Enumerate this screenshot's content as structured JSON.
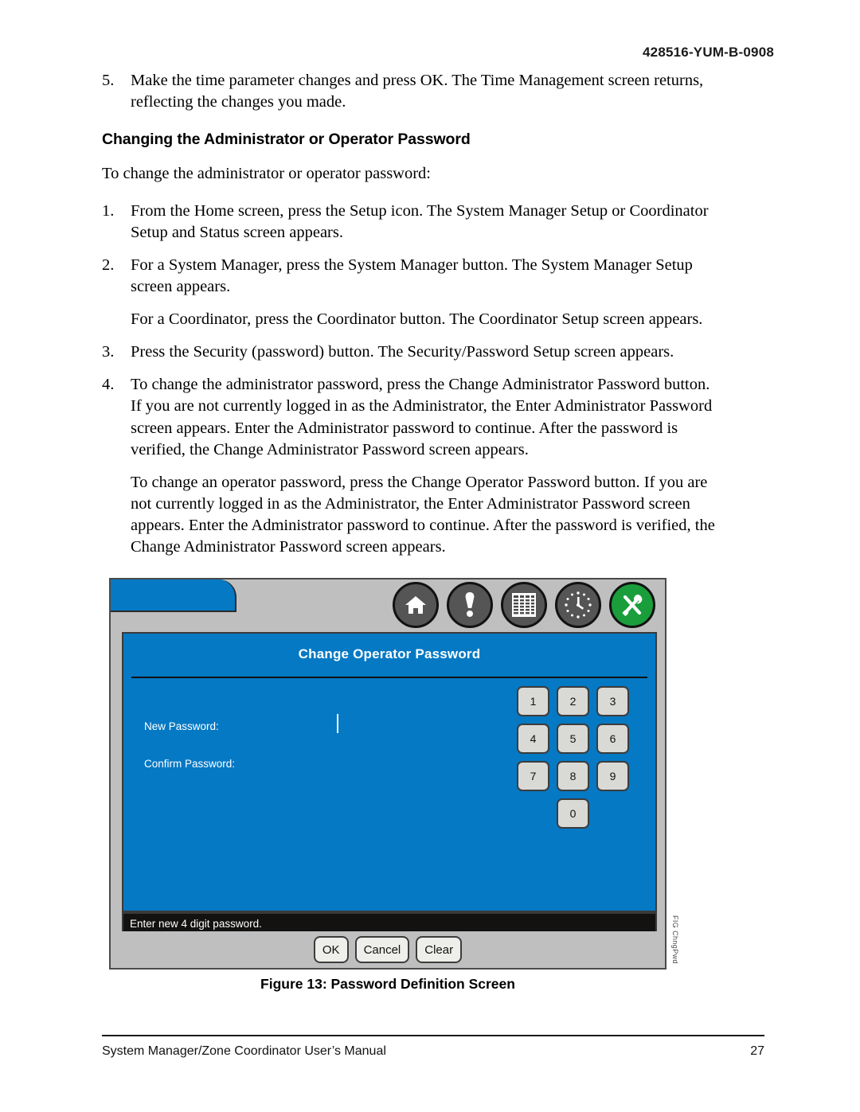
{
  "header": {
    "doc_code": "428516-YUM-B-0908"
  },
  "body": {
    "item5": {
      "num": "5.",
      "text": "Make the time parameter changes and press OK. The Time Management screen returns, reflecting the changes you made."
    },
    "heading": "Changing the Administrator or Operator Password",
    "lead": "To change the administrator or operator password:",
    "item1": {
      "num": "1.",
      "text": "From the Home screen, press the Setup icon. The System Manager Setup or Coordinator Setup and Status screen appears."
    },
    "item2": {
      "num": "2.",
      "text": "For a System Manager, press the System Manager button. The System Manager Setup screen appears."
    },
    "item2b": "For a Coordinator, press the Coordinator button. The Coordinator Setup screen appears.",
    "item3": {
      "num": "3.",
      "text": "Press the Security (password) button. The Security/Password Setup screen appears."
    },
    "item4": {
      "num": "4.",
      "text": "To change the administrator password, press the Change Administrator Password button. If you are not currently logged in as the Administrator, the Enter Administrator Password screen appears. Enter the Administrator password to continue. After the password is verified, the Change Administrator Password screen appears."
    },
    "item4b": "To change an operator password, press the Change Operator Password button. If you are not currently logged in as the Administrator, the Enter Administrator Password screen appears. Enter the Administrator password to continue. After the password is verified, the Change Administrator Password screen appears."
  },
  "figure": {
    "caption": "Figure 13: Password Definition Screen",
    "side_code": "FIG ChngPwd",
    "screen": {
      "title": "Change Operator Password",
      "labels": {
        "new_password": "New Password:",
        "confirm_password": "Confirm Password:"
      },
      "field_values": {
        "new_password": "",
        "confirm_password": ""
      },
      "toolbar_icons": [
        {
          "name": "home-icon",
          "glyph": "⌂",
          "active": false
        },
        {
          "name": "alarm-icon",
          "glyph": "!",
          "active": false
        },
        {
          "name": "table-icon",
          "glyph": "▦",
          "active": false
        },
        {
          "name": "clock-icon",
          "glyph": "◴",
          "active": false
        },
        {
          "name": "tools-icon",
          "glyph": "⚒",
          "active": true
        }
      ],
      "keypad": [
        "1",
        "2",
        "3",
        "4",
        "5",
        "6",
        "7",
        "8",
        "9",
        "0"
      ],
      "status_text": "Enter new 4 digit password.",
      "buttons": [
        "OK",
        "Cancel",
        "Clear"
      ]
    },
    "colors": {
      "panel_blue": "#0579c4",
      "toolbar_gray": "#bfbfbf",
      "status_black": "#141210",
      "accent_green": "#1a9e3c",
      "key_face": "#d9d9d6"
    }
  },
  "footer": {
    "manual_title": "System Manager/Zone Coordinator User’s Manual",
    "page_number": "27"
  }
}
